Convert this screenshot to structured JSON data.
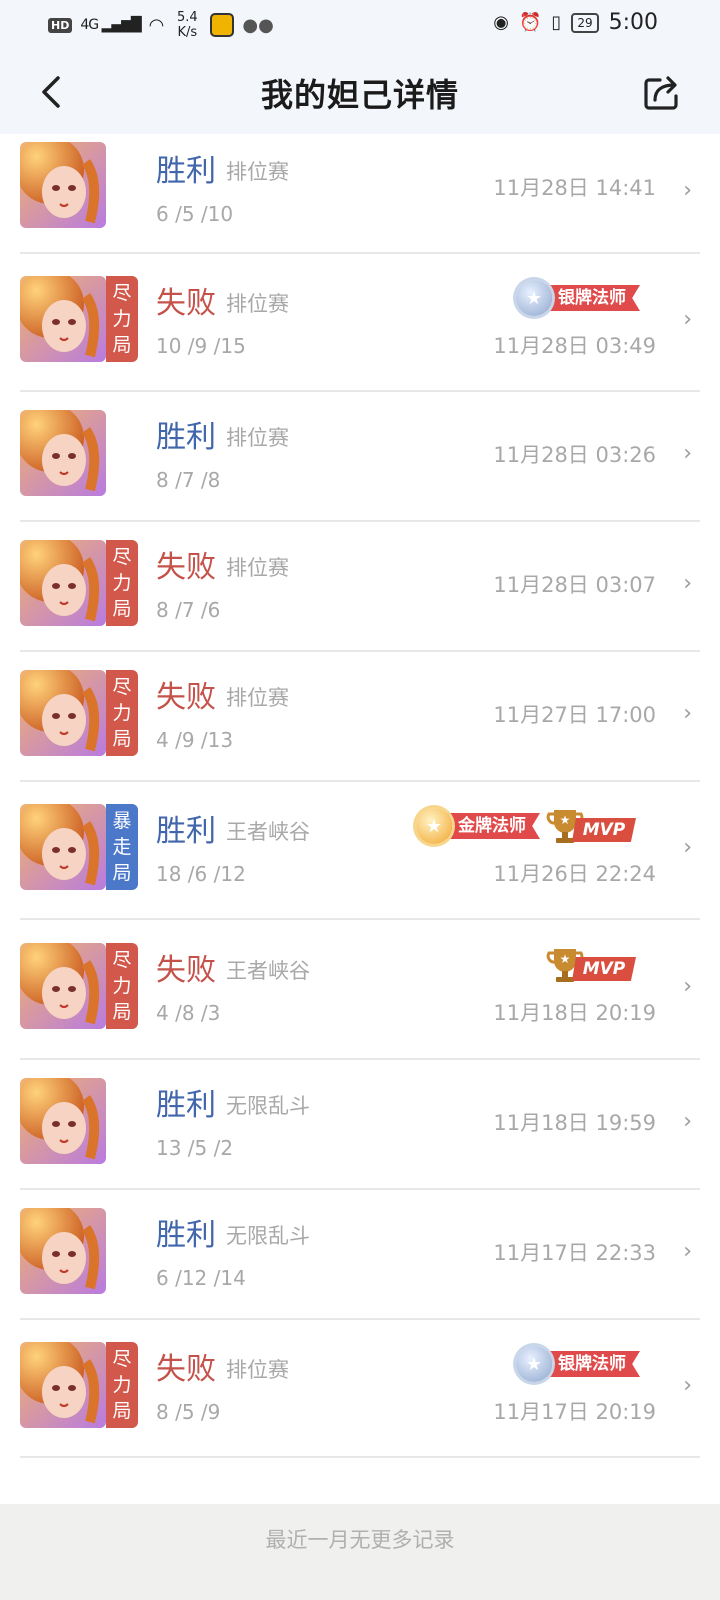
{
  "status_bar": {
    "hd": "HD",
    "network": "4G",
    "speed": "5.4 K/s",
    "battery": "29",
    "time": "5:00"
  },
  "header": {
    "title": "我的妲己详情"
  },
  "matches": [
    {
      "result": "胜利",
      "mode": "排位赛",
      "kda": "6 /5 /10",
      "time": "11月28日 14:41",
      "tag": "",
      "badge": "",
      "mvp": false
    },
    {
      "result": "失败",
      "mode": "排位赛",
      "kda": "10 /9 /15",
      "time": "11月28日 03:49",
      "tag": "尽力局",
      "badge": "银牌法师",
      "mvp": false
    },
    {
      "result": "胜利",
      "mode": "排位赛",
      "kda": "8 /7 /8",
      "time": "11月28日 03:26",
      "tag": "",
      "badge": "",
      "mvp": false
    },
    {
      "result": "失败",
      "mode": "排位赛",
      "kda": "8 /7 /6",
      "time": "11月28日 03:07",
      "tag": "尽力局",
      "badge": "",
      "mvp": false
    },
    {
      "result": "失败",
      "mode": "排位赛",
      "kda": "4 /9 /13",
      "time": "11月27日 17:00",
      "tag": "尽力局",
      "badge": "",
      "mvp": false
    },
    {
      "result": "胜利",
      "mode": "王者峡谷",
      "kda": "18 /6 /12",
      "time": "11月26日 22:24",
      "tag": "暴走局",
      "badge": "金牌法师",
      "mvp": true,
      "mvp_label": "MVP"
    },
    {
      "result": "失败",
      "mode": "王者峡谷",
      "kda": "4 /8 /3",
      "time": "11月18日 20:19",
      "tag": "尽力局",
      "badge": "",
      "mvp": true,
      "mvp_label": "MVP"
    },
    {
      "result": "胜利",
      "mode": "无限乱斗",
      "kda": "13 /5 /2",
      "time": "11月18日 19:59",
      "tag": "",
      "badge": "",
      "mvp": false
    },
    {
      "result": "胜利",
      "mode": "无限乱斗",
      "kda": "6 /12 /14",
      "time": "11月17日 22:33",
      "tag": "",
      "badge": "",
      "mvp": false
    },
    {
      "result": "失败",
      "mode": "排位赛",
      "kda": "8 /5 /9",
      "time": "11月17日 20:19",
      "tag": "尽力局",
      "badge": "银牌法师",
      "mvp": false
    }
  ],
  "footer": {
    "text": "最近一月无更多记录"
  },
  "colors": {
    "win": "#4166ab",
    "lose": "#c5524a",
    "tag_red": "#d2584b",
    "tag_blue": "#4b78c9",
    "muted": "#a8a8a8"
  },
  "icons": {
    "back": "chevron-left-icon",
    "share": "share-icon",
    "row_arrow": "chevron-right-icon",
    "avatar": "hero-avatar"
  }
}
